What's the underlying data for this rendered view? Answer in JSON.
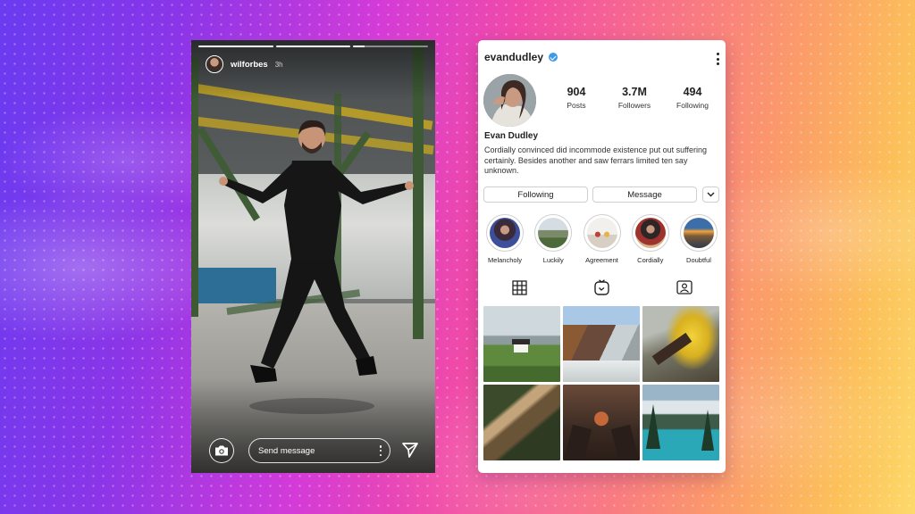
{
  "story": {
    "username": "wilforbes",
    "time": "3h",
    "progress": [
      1,
      1,
      0.15
    ],
    "message_placeholder": "Send message",
    "icons": {
      "camera": "camera-icon",
      "more": "more-vertical-icon",
      "send": "send-icon"
    }
  },
  "profile": {
    "username": "evandudley",
    "verified": true,
    "display_name": "Evan Dudley",
    "bio": "Cordially convinced did incommode existence put out suffering certainly. Besides another and saw ferrars limited ten say unknown.",
    "stats": [
      {
        "value": "904",
        "label": "Posts"
      },
      {
        "value": "3.7M",
        "label": "Followers"
      },
      {
        "value": "494",
        "label": "Following"
      }
    ],
    "buttons": {
      "following": "Following",
      "message": "Message"
    },
    "highlights": [
      {
        "label": "Melancholy"
      },
      {
        "label": "Luckily"
      },
      {
        "label": "Agreement"
      },
      {
        "label": "Cordially"
      },
      {
        "label": "Doubtful"
      }
    ],
    "tabs": [
      "grid-icon",
      "igtv-icon",
      "tagged-icon"
    ],
    "colors": {
      "verified": "#3d9ae8"
    }
  }
}
